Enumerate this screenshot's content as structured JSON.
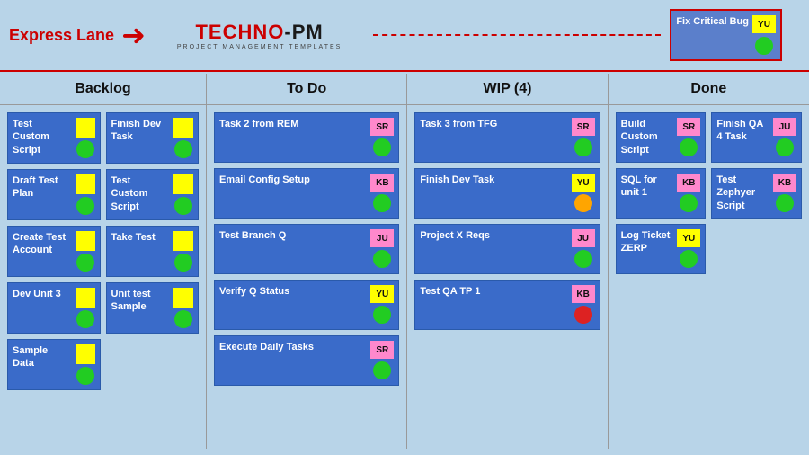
{
  "express_lane": {
    "label": "Express Lane",
    "card": {
      "text": "Fix Critical Bug",
      "badge": "YU",
      "badge_color": "yellow"
    }
  },
  "logo": {
    "main": "TECHNO-PM",
    "sub": "PROJECT MANAGEMENT TEMPLATES"
  },
  "columns": [
    {
      "id": "backlog",
      "header": "Backlog"
    },
    {
      "id": "todo",
      "header": "To Do"
    },
    {
      "id": "wip",
      "header": "WIP (4)"
    },
    {
      "id": "done",
      "header": "Done"
    }
  ],
  "backlog_col1": [
    {
      "text": "Test Custom Script",
      "badge": null,
      "circle": "green"
    },
    {
      "text": "Draft Test Plan",
      "badge": null,
      "circle": "green"
    },
    {
      "text": "Create Test Account",
      "badge": null,
      "circle": "green"
    },
    {
      "text": "Dev Unit 3",
      "badge": null,
      "circle": "green"
    },
    {
      "text": "Sample Data",
      "badge": null,
      "circle": "green"
    }
  ],
  "backlog_col2": [
    {
      "text": "Finish Dev Task",
      "badge": null,
      "circle": "green"
    },
    {
      "text": "Test Custom Script",
      "badge": null,
      "circle": "green"
    },
    {
      "text": "Take Test",
      "badge": null,
      "circle": "green"
    },
    {
      "text": "Unit test Sample",
      "badge": null,
      "circle": "green"
    }
  ],
  "todo_cards": [
    {
      "text": "Task 2 from REM",
      "badge": "SR",
      "badge_color": "pink",
      "circle": "green"
    },
    {
      "text": "Email Config Setup",
      "badge": "KB",
      "badge_color": "pink",
      "circle": "green"
    },
    {
      "text": "Test Branch Q",
      "badge": "JU",
      "badge_color": "pink",
      "circle": "green"
    },
    {
      "text": "Verify Q Status",
      "badge": "YU",
      "badge_color": "yellow",
      "circle": "green"
    },
    {
      "text": "Execute Daily Tasks",
      "badge": "SR",
      "badge_color": "pink",
      "circle": "green"
    }
  ],
  "wip_cards": [
    {
      "text": "Task 3 from TFG",
      "badge": "SR",
      "badge_color": "pink",
      "circle": "green"
    },
    {
      "text": "Finish Dev Task",
      "badge": "YU",
      "badge_color": "yellow",
      "circle": "orange"
    },
    {
      "text": "Project X Reqs",
      "badge": "JU",
      "badge_color": "pink",
      "circle": "green"
    },
    {
      "text": "Test QA TP 1",
      "badge": "KB",
      "badge_color": "pink",
      "circle": "red"
    }
  ],
  "done_cards": [
    {
      "text": "Build Custom Script",
      "badge": "SR",
      "badge_color": "pink",
      "circle": "green"
    },
    {
      "text": "Finish QA 4 Task",
      "badge": "JU",
      "badge_color": "pink",
      "circle": "green"
    },
    {
      "text": "SQL for unit 1",
      "badge": "KB",
      "badge_color": "pink",
      "circle": "green"
    },
    {
      "text": "Test Zephyer Script",
      "badge": "KB",
      "badge_color": "pink",
      "circle": "green"
    },
    {
      "text": "Log Ticket ZERP",
      "badge": "YU",
      "badge_color": "yellow",
      "circle": "green"
    }
  ]
}
